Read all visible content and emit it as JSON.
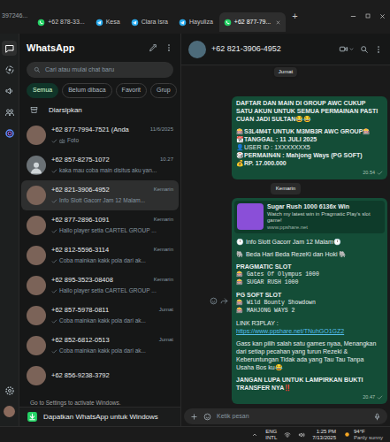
{
  "window": {
    "title": "397246..."
  },
  "tabs": [
    {
      "label": "+62 878-33...",
      "kind": "whatsapp",
      "selected": false
    },
    {
      "label": "Kesa",
      "kind": "telegram",
      "selected": false
    },
    {
      "label": "Clara Isra",
      "kind": "telegram",
      "selected": false
    },
    {
      "label": "Hayuliza",
      "kind": "telegram",
      "selected": false
    },
    {
      "label": "+62 877-79...",
      "kind": "whatsapp",
      "selected": true
    }
  ],
  "new_tab": "+",
  "rail": {
    "items": [
      {
        "kind": "chats",
        "selected": true
      },
      {
        "kind": "status",
        "selected": false
      },
      {
        "kind": "channels",
        "selected": false
      },
      {
        "kind": "communities",
        "selected": false
      },
      {
        "kind": "meta-ai",
        "selected": false
      }
    ],
    "bottom": [
      {
        "kind": "settings",
        "selected": false
      },
      {
        "kind": "profile",
        "selected": false
      }
    ]
  },
  "sidebar": {
    "title": "WhatsApp",
    "search": {
      "placeholder": "Cari atau mulai chat baru"
    },
    "filters": [
      {
        "label": "Semua",
        "selected": true
      },
      {
        "label": "Belum dibaca",
        "selected": false
      },
      {
        "label": "Favorit",
        "selected": false
      },
      {
        "label": "Grup",
        "selected": false
      }
    ],
    "archived": "Diarsipkan",
    "chats": [
      {
        "name": "+62 877-7994-7521 (Anda",
        "time": "11/6/2025",
        "preview": "Foto",
        "tick": true,
        "photo": true,
        "avatar": "photo",
        "selected": false
      },
      {
        "name": "+62 857-8275-1072",
        "time": "10.27",
        "preview": "kaka mau coba main disitus aku yan...",
        "tick": true,
        "photo": false,
        "avatar": "default",
        "selected": false
      },
      {
        "name": "+62 821-3906-4952",
        "time": "Kemarin",
        "preview": "Info Slott Gacorr Jam 12 Malam...",
        "tick": true,
        "photo": false,
        "avatar": "photo",
        "selected": true
      },
      {
        "name": "+62 877-2896-1091",
        "time": "Kemarin",
        "preview": "Hallo player setia CARTEL GROUP ...",
        "tick": true,
        "photo": false,
        "avatar": "photo",
        "selected": false
      },
      {
        "name": "+62 812-5596-3114",
        "time": "Kemarin",
        "preview": "Coba mainkan kakk pola dari ak...",
        "tick": true,
        "photo": false,
        "avatar": "photo",
        "selected": false
      },
      {
        "name": "+62 895-3523-08408",
        "time": "Kemarin",
        "preview": "Hallo player setia CARTEL GROUP ...",
        "tick": true,
        "photo": false,
        "avatar": "photo",
        "selected": false
      },
      {
        "name": "+62 857-5978-0811",
        "time": "Jumat",
        "preview": "Coba mainkan kakk pola dari ak...",
        "tick": true,
        "photo": false,
        "avatar": "photo",
        "selected": false
      },
      {
        "name": "+62 852-6812-0513",
        "time": "Jumat",
        "preview": "Coba mainkan kakk pola dari ak...",
        "tick": true,
        "photo": false,
        "avatar": "photo",
        "selected": false
      },
      {
        "name": "+62 856-9238-3792",
        "avatar": "photo",
        "selected": false
      }
    ],
    "watermark": "Go to Settings to activate Windows.",
    "banner": "Dapatkan WhatsApp untuk Windows"
  },
  "chat": {
    "title": "+62 821-3906-4952",
    "sticky_date": "Jumat",
    "messages": [
      {
        "kind": "message",
        "time": "20.54",
        "tick": true,
        "blocks": [
          [
            {
              "text": "DAFTAR DAN MAIN DI GROUP AWC CUKUP SATU AKUN UNTUK SEMUA PERMAINAN PASTI CUAN JADI SULTAN😂😂",
              "kind": "bold"
            }
          ],
          [
            {
              "text": "🎰S3L4M4T UNTUK M3MB3R AWC GROUP🎰",
              "kind": "bold"
            },
            {
              "text": "📆TANGGAL : 11 JULI 2025",
              "kind": "bold"
            },
            {
              "text": "👤USER ID : 1XXXXXXX5",
              "kind": "plain"
            },
            {
              "text": "🎲PERMAIN4N : Mahjong Ways (PG SOFT)",
              "kind": "bold"
            },
            {
              "text": "💰RP. 17.000.000",
              "kind": "bold"
            }
          ]
        ]
      },
      {
        "kind": "date",
        "text": "Kemarin"
      },
      {
        "kind": "message",
        "time": "20.47",
        "tick": true,
        "preview": {
          "title": "Sugar Rush 1000 6136x Win",
          "description": "Watch my latest win in Pragmatic Play's slot game!",
          "domain": "www.ppshare.net"
        },
        "blocks": [
          [
            {
              "text": "🕛 Info Slott Gacorr Jam 12 Malam🕛",
              "kind": "plain"
            }
          ],
          [
            {
              "text": "🐘 Beda Hari Beda RezeKi dan Hoki 🐘",
              "kind": "plain"
            }
          ],
          [
            {
              "text": "PRAGMATIC SLOT",
              "kind": "bold"
            },
            {
              "text": "🎰 Gates Of Olympus 1000",
              "kind": "mono"
            },
            {
              "text": "🎰 SUGAR RUSH 1000",
              "kind": "mono"
            }
          ],
          [
            {
              "text": "PG SOFT SLOT",
              "kind": "bold"
            },
            {
              "text": "🎰 Wild Bounty Showdown",
              "kind": "mono"
            },
            {
              "text": "🎰 MAHJONG WAYS 2",
              "kind": "mono"
            }
          ],
          [
            {
              "text": "LINK R3PLAY :",
              "kind": "plain"
            },
            {
              "text": "https://www.ppshare.net/TNuhGO1GZ2",
              "kind": "link"
            }
          ],
          [
            {
              "text": "Gass kan pilih salah satu games nyaa, Menangkan dari setiap pecahan yang turun Rezeki & Keberuntungan Tidak ada yang Tau Tau Tanpa Usaha Bos ku😂",
              "kind": "plain"
            }
          ],
          [
            {
              "text": "JANGAN LUPA UNTUK LAMPIRKAN BUKTI TRANSFER NYA‼️",
              "kind": "bold"
            }
          ]
        ]
      }
    ]
  },
  "composer": {
    "placeholder": "Ketik pesan"
  },
  "taskbar": {
    "language": "ENG",
    "layout": "INTL",
    "time": "1:25 PM",
    "date": "7/13/2025",
    "temperature": "94°F",
    "weather": "Partly sunny"
  }
}
